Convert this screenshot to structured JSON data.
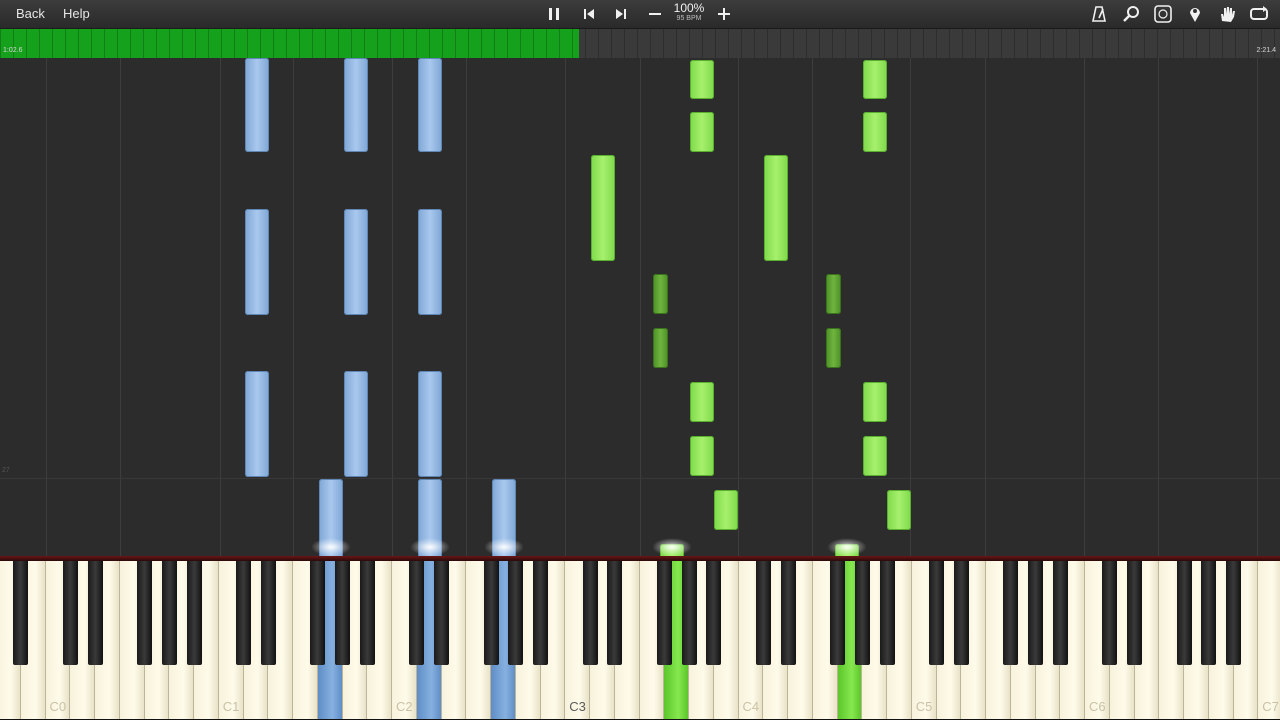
{
  "toolbar": {
    "back_label": "Back",
    "help_label": "Help",
    "speed_percent": "100%",
    "bpm_label": "95 BPM",
    "icons": [
      "pause-icon",
      "skip-back-icon",
      "skip-forward-icon",
      "minus-icon",
      "plus-icon",
      "metronome-icon",
      "search-icon",
      "note-label-icon",
      "marker-icon",
      "hand-icon",
      "loop-icon"
    ]
  },
  "progress": {
    "current_time": "1:02.6",
    "total_time": "2:21.4",
    "fraction": 0.452
  },
  "keyboard": {
    "octave_labels": [
      "C0",
      "C1",
      "C2",
      "C3",
      "C4",
      "C5",
      "C6",
      "C7"
    ],
    "colors": {
      "left_hand": "#86b0e0",
      "right_hand": "#86e84f"
    }
  },
  "roll": {
    "measure_marker": "27"
  }
}
